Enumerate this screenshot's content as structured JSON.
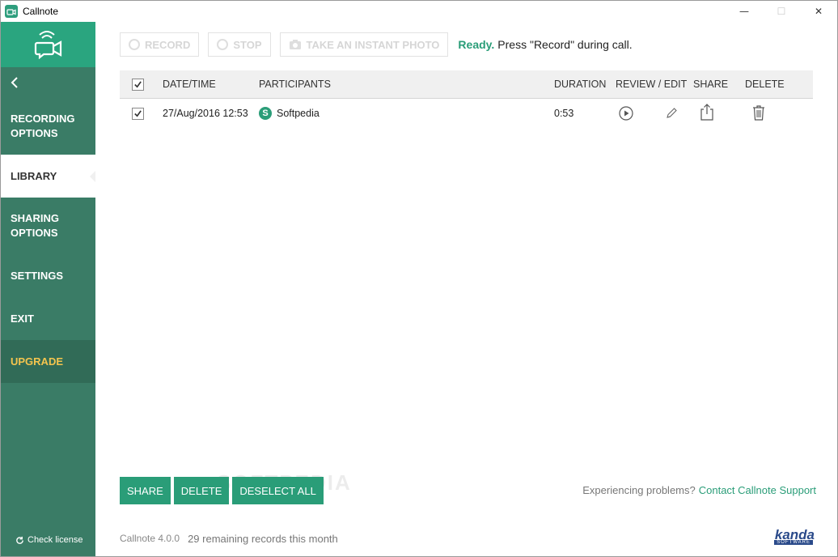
{
  "window": {
    "title": "Callnote",
    "controls": [
      "—",
      "☐",
      "✕"
    ]
  },
  "sidebar": {
    "items": [
      {
        "label_lines": [
          "RECORDING",
          "OPTIONS"
        ]
      },
      {
        "label_lines": [
          "LIBRARY"
        ]
      },
      {
        "label_lines": [
          "SHARING",
          "OPTIONS"
        ]
      },
      {
        "label_lines": [
          "SETTINGS"
        ]
      },
      {
        "label_lines": [
          "EXIT"
        ]
      },
      {
        "label_lines": [
          "UPGRADE"
        ]
      }
    ],
    "active_index": 1,
    "check_license": "Check license"
  },
  "toolbar": {
    "record_label": "RECORD",
    "stop_label": "STOP",
    "photo_label": "TAKE AN INSTANT PHOTO",
    "status_ready": "Ready.",
    "status_text": "Press \"Record\" during call."
  },
  "table": {
    "headers": {
      "date": "DATE/TIME",
      "participants": "PARTICIPANTS",
      "duration": "DURATION",
      "review": "REVIEW / EDIT",
      "share": "SHARE",
      "delete": "DELETE"
    },
    "rows": [
      {
        "checked": true,
        "date": "27/Aug/2016 12:53",
        "participant": "Softpedia",
        "duration": "0:53"
      }
    ]
  },
  "actions": {
    "share_label": "SHARE",
    "delete_label": "DELETE",
    "deselect_label": "DESELECT ALL"
  },
  "support": {
    "prompt": "Experiencing problems?",
    "link": "Contact Callnote Support"
  },
  "watermark": "SOFTPEDIA",
  "footer": {
    "version": "Callnote 4.0.0",
    "remaining": "29 remaining records this month",
    "brand": "kanda",
    "brand_sub": "SOFTWARE"
  },
  "colors": {
    "accent": "#2a9d78",
    "sidebar": "#3a7c66",
    "upgrade_text": "#f4c44e"
  }
}
